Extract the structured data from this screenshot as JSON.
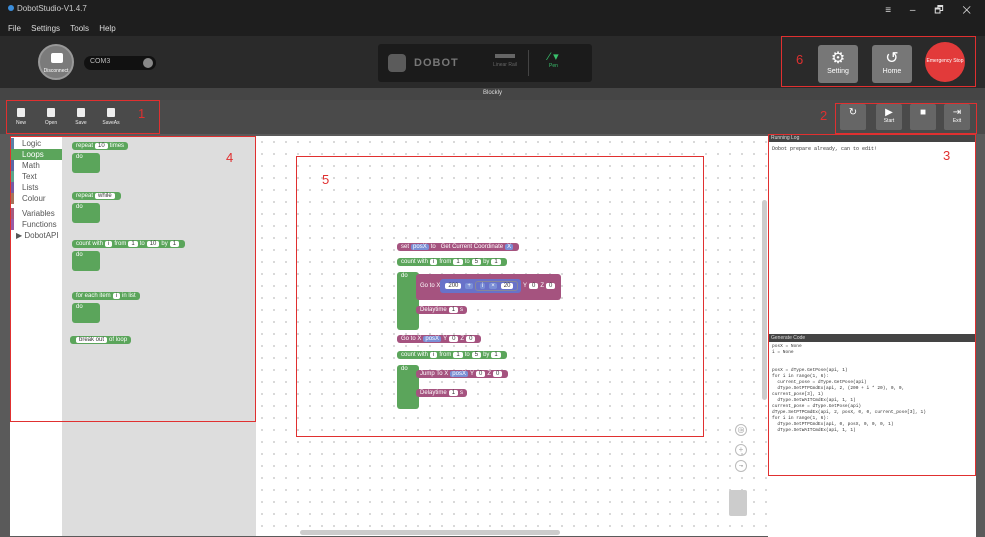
{
  "window": {
    "title": "DobotStudio-V1.4.7",
    "controls": [
      "≡",
      "–",
      "🗗",
      "✕"
    ]
  },
  "menu": [
    "File",
    "Settings",
    "Tools",
    "Help"
  ],
  "header": {
    "connect_label": "Disconnect",
    "port_value": "COM3",
    "device_logo": "DOBOT",
    "tool_linear": "Linear Rail",
    "tool_pen": "Pen",
    "setting_label": "Setting",
    "home_label": "Home",
    "estop_label": "Emergency Stop"
  },
  "studio_title": "Blockly",
  "toolbar": {
    "buttons": [
      {
        "label": "New"
      },
      {
        "label": "Open"
      },
      {
        "label": "Save"
      },
      {
        "label": "SaveAs"
      }
    ],
    "run": [
      {
        "label": ""
      },
      {
        "label": "Start"
      },
      {
        "label": ""
      },
      {
        "label": "Exit"
      }
    ]
  },
  "categories": [
    "Logic",
    "Loops",
    "Math",
    "Text",
    "Lists",
    "Colour",
    "Variables",
    "Functions",
    "DobotAPI"
  ],
  "flyout": {
    "repeat": [
      "repeat",
      "10",
      "times",
      "do"
    ],
    "repeat_while": [
      "repeat",
      "while",
      "do"
    ],
    "count": [
      "count with",
      "i",
      "from",
      "1",
      "to",
      "10",
      "by",
      "1",
      "do"
    ],
    "foreach": [
      "for each item",
      "i",
      "in list",
      "do"
    ],
    "break": [
      "break out",
      "of loop"
    ]
  },
  "program": {
    "set_var": [
      "set",
      "posX",
      "to",
      "Get Current Coordinate",
      "X"
    ],
    "count1": [
      "count with",
      "i",
      "from",
      "1",
      "to",
      "5",
      "by",
      "1"
    ],
    "do": "do",
    "goto1": [
      "Go to",
      "X",
      "200",
      "+",
      "",
      "i",
      "×",
      "20",
      "Y",
      "0",
      "Z",
      "0"
    ],
    "delay1": [
      "Delaytime",
      "1",
      "s"
    ],
    "goto2": [
      "Go to",
      "X",
      "posX",
      "Y",
      "0",
      "Z",
      "0"
    ],
    "count2": [
      "count with",
      "i",
      "from",
      "1",
      "to",
      "5",
      "by",
      "1"
    ],
    "jump": [
      "Jump To",
      "X",
      "posX",
      "Y",
      "0",
      "Z",
      "0"
    ],
    "delay2": [
      "Delaytime",
      "1",
      "s"
    ]
  },
  "running_log": {
    "title": "Running Log",
    "text": "Dobot prepare already, can to edit!"
  },
  "generated_code": {
    "title": "Generate Code",
    "lines": [
      "posX = None",
      "i = None",
      "",
      "",
      "posX = dType.GetPose(api, 1)",
      "for i in range(1, 6):",
      "  current_pose = dType.GetPose(api)",
      "  dType.SetPTPCmdEx(api, 2, (200 + i * 20), 0, 0,",
      "current_pose[3], 1)",
      "  dType.SetWAITCmdEx(api, 1, 1)",
      "current_pose = dType.GetPose(api)",
      "dType.SetPTPCmdEx(api, 2, posX, 0, 0, current_pose[3], 1)",
      "for i in range(1, 6):",
      "  dType.SetPTPCmdEx(api, 0, posX, 0, 0, 0, 1)",
      "  dType.SetWAITCmdEx(api, 1, 1)"
    ]
  },
  "annotations": [
    "1",
    "2",
    "3",
    "4",
    "5",
    "6"
  ],
  "colors": {
    "annotation": "#e03030",
    "loops": "#5ba55b",
    "dobot": "#a5537f",
    "math": "#6872c9",
    "estop": "#e23a3a"
  }
}
